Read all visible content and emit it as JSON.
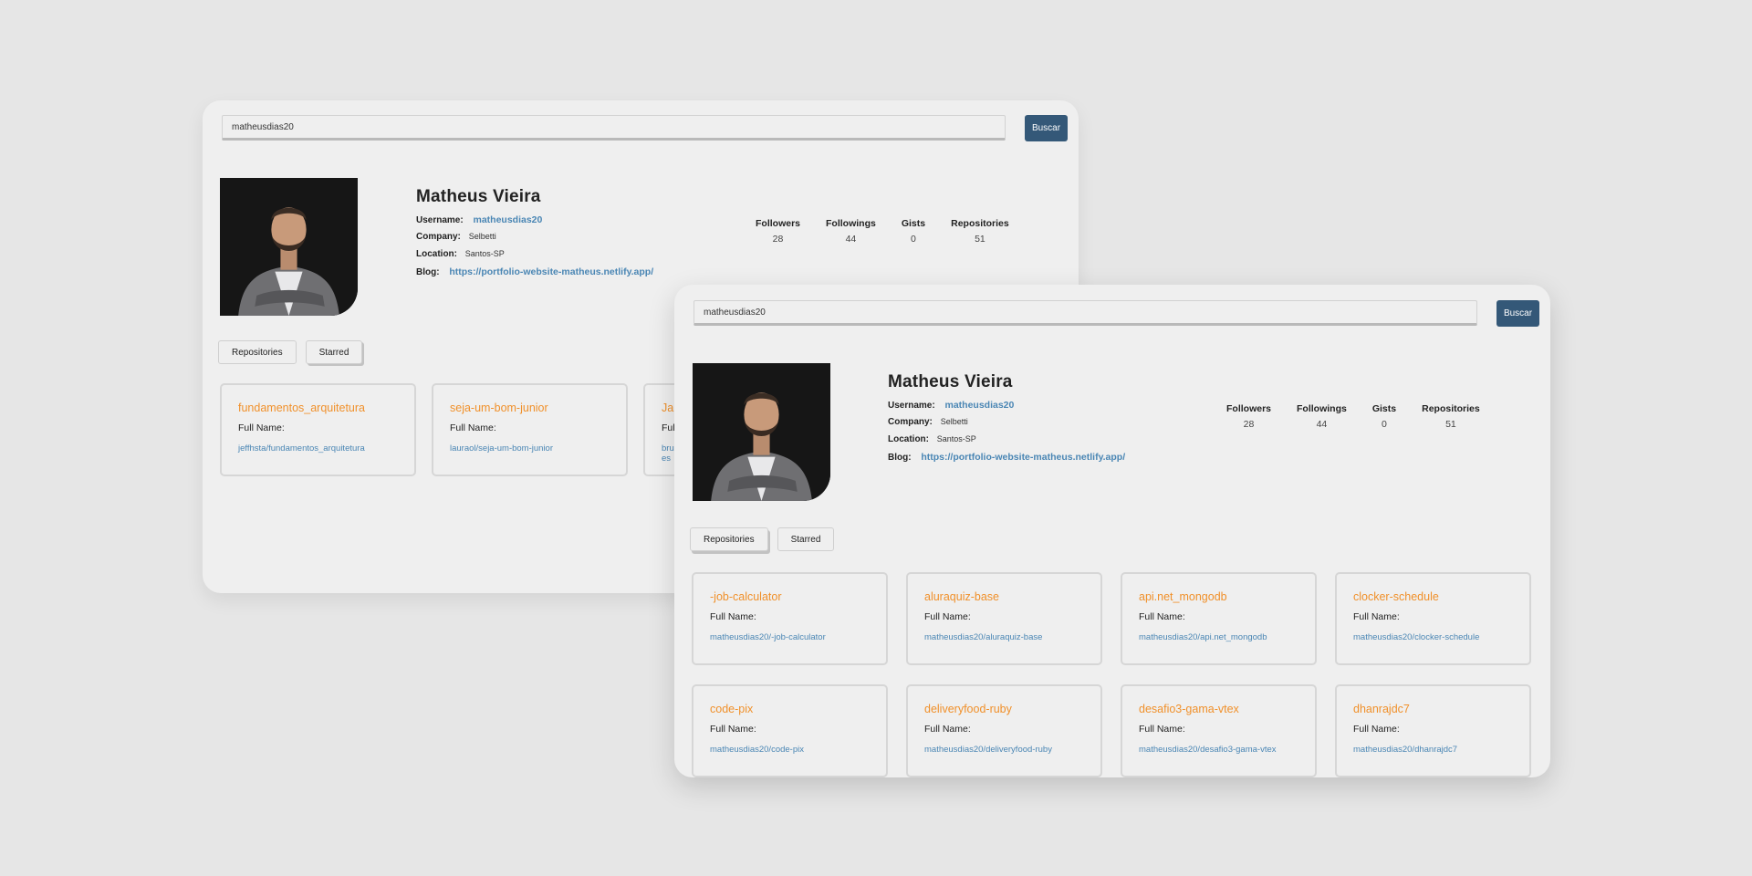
{
  "profile": {
    "name": "Matheus Vieira",
    "username_label": "Username:",
    "username": "matheusdias20",
    "company_label": "Company:",
    "company": "Selbetti",
    "location_label": "Location:",
    "location": "Santos-SP",
    "blog_label": "Blog:",
    "blog": "https://portfolio-website-matheus.netlify.app/"
  },
  "search": {
    "value": "matheusdias20",
    "button_label": "Buscar"
  },
  "stats": [
    {
      "label": "Followers",
      "value": "28"
    },
    {
      "label": "Followings",
      "value": "44"
    },
    {
      "label": "Gists",
      "value": "0"
    },
    {
      "label": "Repositories",
      "value": "51"
    }
  ],
  "tabs": {
    "repositories": "Repositories",
    "starred": "Starred"
  },
  "full_name_label": "Full Name:",
  "back_window_repos": [
    {
      "name": "fundamentos_arquitetura",
      "link": "jeffhsta/fundamentos_arquitetura"
    },
    {
      "name": "seja-um-bom-junior",
      "link": "lauraol/seja-um-bom-junior"
    },
    {
      "name": "Ja",
      "link": "bru",
      "link2": "es"
    }
  ],
  "front_window_repos": [
    {
      "name": "-job-calculator",
      "link": "matheusdias20/-job-calculator"
    },
    {
      "name": "aluraquiz-base",
      "link": "matheusdias20/aluraquiz-base"
    },
    {
      "name": "api.net_mongodb",
      "link": "matheusdias20/api.net_mongodb"
    },
    {
      "name": "clocker-schedule",
      "link": "matheusdias20/clocker-schedule"
    },
    {
      "name": "code-pix",
      "link": "matheusdias20/code-pix"
    },
    {
      "name": "deliveryfood-ruby",
      "link": "matheusdias20/deliveryfood-ruby"
    },
    {
      "name": "desafio3-gama-vtex",
      "link": "matheusdias20/desafio3-gama-vtex"
    },
    {
      "name": "dhanrajdc7",
      "link": "matheusdias20/dhanrajdc7"
    }
  ],
  "colors": {
    "background": "#e6e6e6",
    "window": "#efefef",
    "button": "#345878",
    "repo_name": "#f0902a",
    "link": "#4a86b4"
  }
}
